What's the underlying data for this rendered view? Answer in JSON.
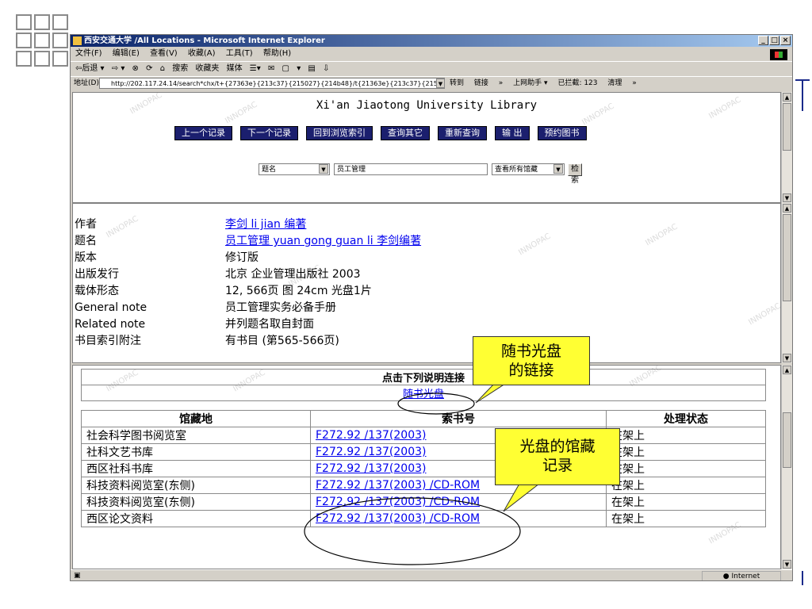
{
  "window": {
    "title": "西安交通大学 /All Locations - Microsoft Internet Explorer",
    "controls": [
      "_",
      "□",
      "×"
    ]
  },
  "menubar": [
    "文件(F)",
    "编辑(E)",
    "查看(V)",
    "收藏(A)",
    "工具(T)",
    "帮助(H)"
  ],
  "toolbar": [
    "⇦后退 ▾",
    "⇨ ▾",
    "⊗",
    "⟳",
    "⌂",
    "搜索",
    "收藏夹",
    "媒体",
    "☰▾",
    "✉",
    "▢",
    "▾",
    "▤",
    "⇩"
  ],
  "addressbar": {
    "label": "地址(D)",
    "url": "http://202.117.24.14/search*chx/t+{27363e}{213c37}{215027}{214b48}/t{21363e}{213c37}{215027",
    "go": "转到",
    "links": "链接",
    "extras": [
      "»",
      "上网助手 ▾",
      "已拦截: 123",
      "清理",
      "»"
    ]
  },
  "library": {
    "title": "Xi'an Jiaotong University Library",
    "nav_buttons": [
      "上一个记录",
      "下一个记录",
      "回到浏览索引",
      "查询其它",
      "重新查询",
      "输 出",
      "预约图书"
    ],
    "search": {
      "field": "题名",
      "query": "员工管理",
      "scope": "查看所有馆藏",
      "button": "检索"
    }
  },
  "record": [
    {
      "label": "作者",
      "value": "李剑 li jian 编著",
      "link": true
    },
    {
      "label": "题名",
      "value": "员工管理 yuan gong guan li 李剑编著",
      "link": true
    },
    {
      "label": "版本",
      "value": "修订版",
      "link": false
    },
    {
      "label": "出版发行",
      "value": "北京 企业管理出版社 2003",
      "link": false
    },
    {
      "label": "载体形态",
      "value": "12, 566页 图 24cm 光盘1片",
      "link": false
    },
    {
      "label": "General note",
      "value": "员工管理实务必备手册",
      "link": false
    },
    {
      "label": "Related note",
      "value": "并列题名取自封面",
      "link": false
    },
    {
      "label": "书目索引附注",
      "value": "有书目 (第565-566页)",
      "link": false
    }
  ],
  "attachments": {
    "header": "点击下列说明连接",
    "link": "随书光盘"
  },
  "holdings": {
    "headers": [
      "馆藏地",
      "索书号",
      "处理状态"
    ],
    "rows": [
      {
        "location": "社会科学图书阅览室",
        "callno": "F272.92 /137(2003)",
        "status": "在架上"
      },
      {
        "location": "社科文艺书库",
        "callno": "F272.92 /137(2003)",
        "status": "在架上"
      },
      {
        "location": "西区社科书库",
        "callno": "F272.92 /137(2003)",
        "status": "在架上"
      },
      {
        "location": "科技资料阅览室(东侧)",
        "callno": "F272.92 /137(2003) /CD-ROM",
        "status": "在架上"
      },
      {
        "location": "科技资料阅览室(东侧)",
        "callno": "F272.92 /137(2003) /CD-ROM",
        "status": "在架上"
      },
      {
        "location": "西区论文资料",
        "callno": "F272.92 /137(2003) /CD-ROM",
        "status": "在架上"
      }
    ]
  },
  "callouts": {
    "disc_link": "随书光盘\n的链接",
    "disc_record": "光盘的馆藏\n记录"
  },
  "statusbar": {
    "zone": "Internet"
  },
  "watermark": "INNOPAC"
}
